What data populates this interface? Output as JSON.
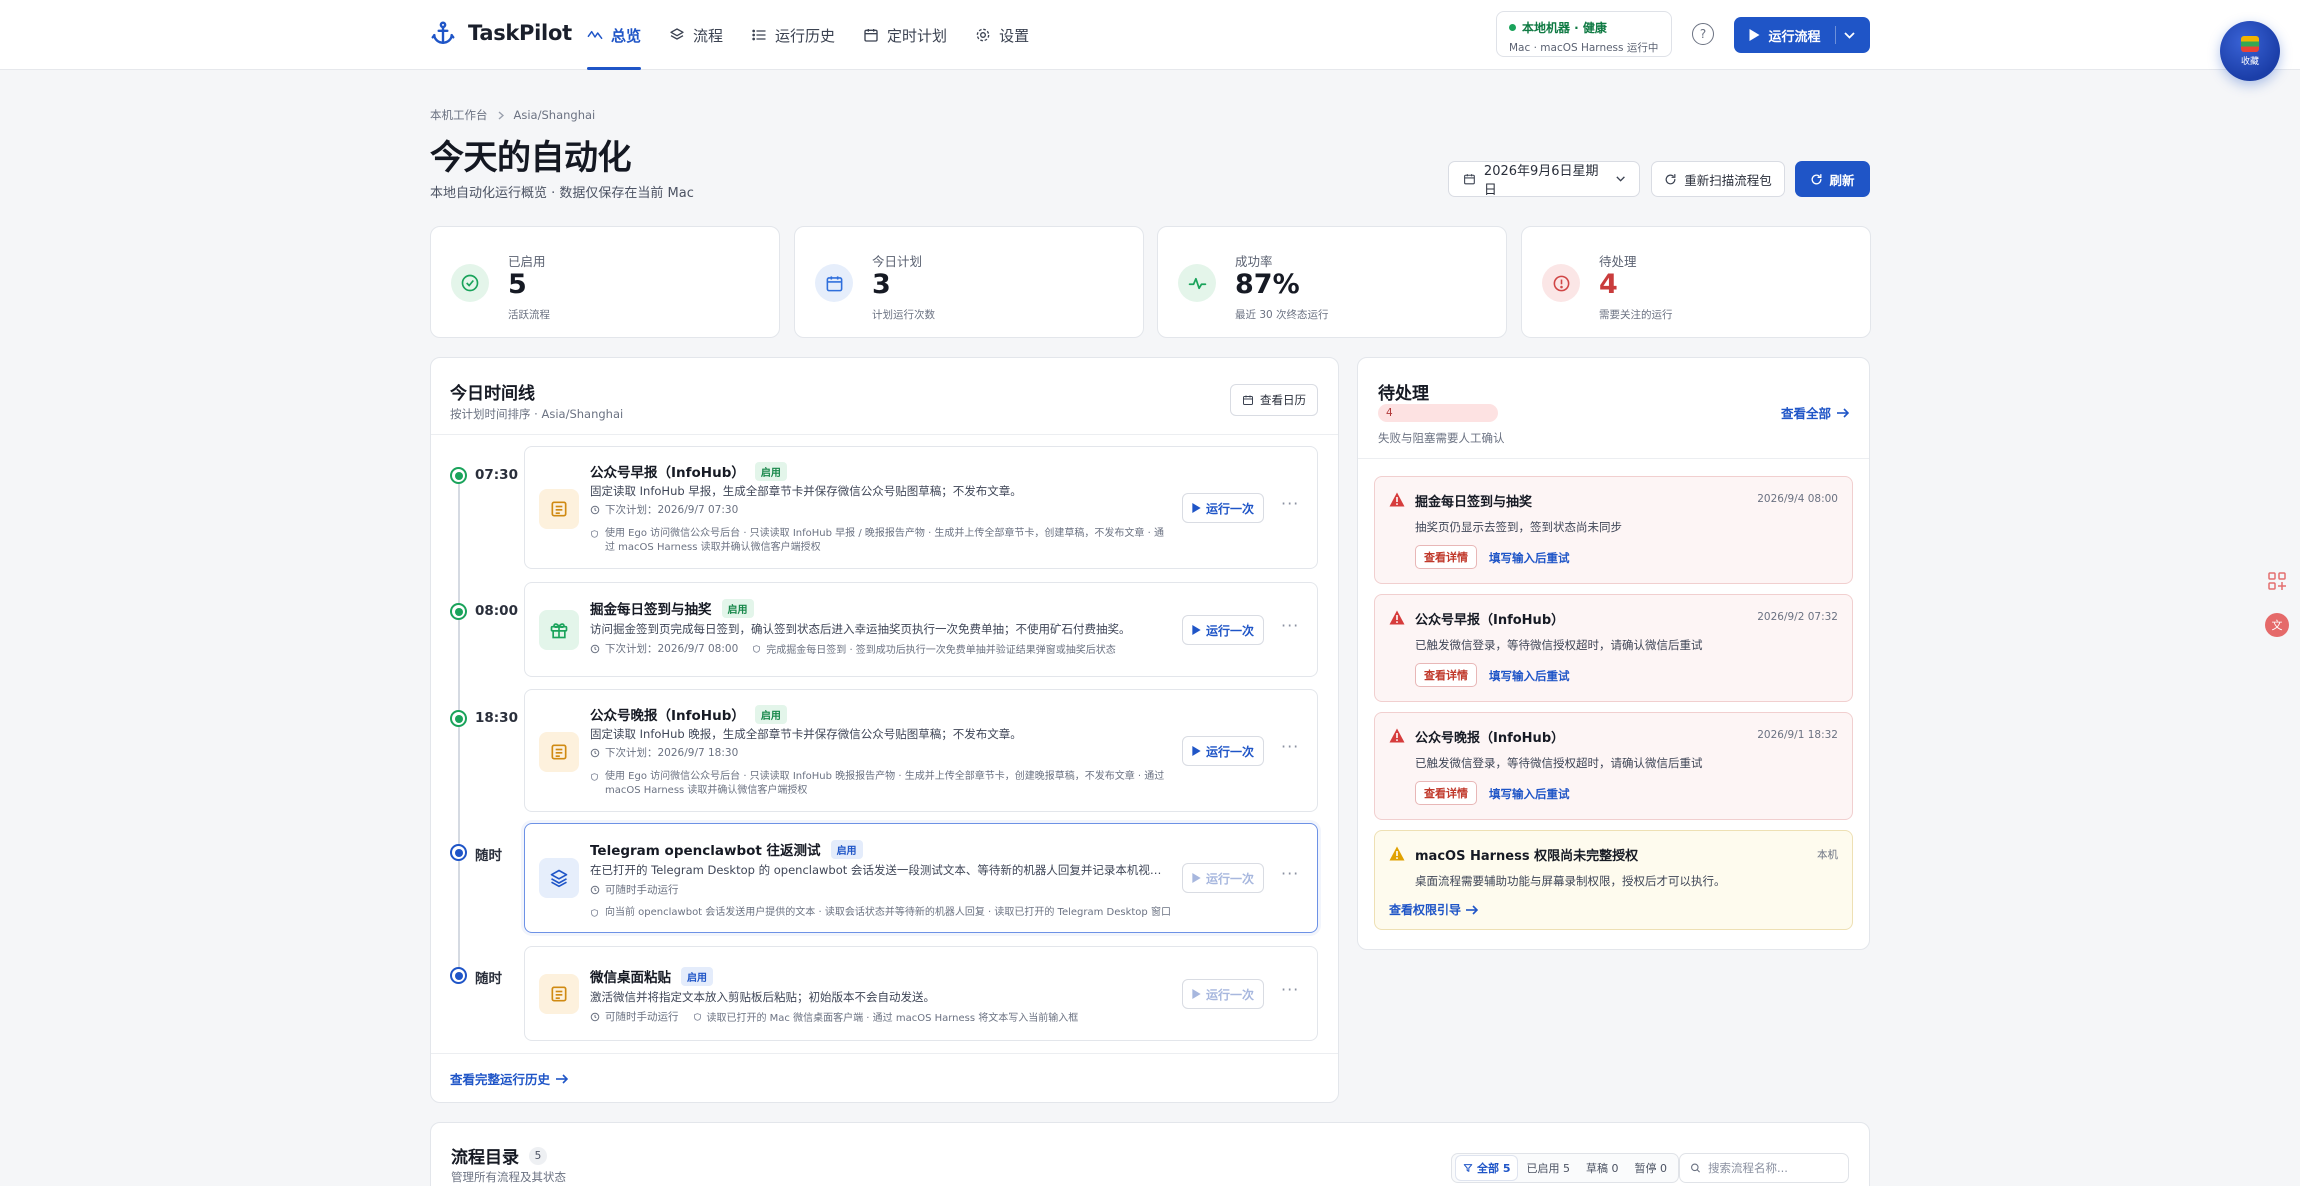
{
  "app": {
    "name": "TaskPilot"
  },
  "nav": {
    "items": [
      {
        "label": "总览",
        "icon": "activity-icon",
        "active": true
      },
      {
        "label": "流程",
        "icon": "layers-icon",
        "active": false
      },
      {
        "label": "运行历史",
        "icon": "list-icon",
        "active": false
      },
      {
        "label": "定时计划",
        "icon": "calendar-icon",
        "active": false
      },
      {
        "label": "设置",
        "icon": "gear-icon",
        "active": false
      }
    ]
  },
  "health": {
    "status": "本地机器 · 健康",
    "detail": "Mac · macOS Harness 运行中"
  },
  "header_actions": {
    "help": "?",
    "run_label": "运行流程"
  },
  "floating_badge": {
    "label": "收藏"
  },
  "breadcrumb": [
    "本机工作台",
    "Asia/Shanghai"
  ],
  "page": {
    "title": "今天的自动化",
    "subtitle": "本地自动化运行概览 · 数据仅保存在当前 Mac"
  },
  "toolbar": {
    "date": "2026年9月6日星期日",
    "rescan": "重新扫描流程包",
    "refresh": "刷新"
  },
  "stats": [
    {
      "label": "已启用",
      "value": "5",
      "note": "活跃流程",
      "color": "#1aa35b"
    },
    {
      "label": "今日计划",
      "value": "3",
      "note": "计划运行次数",
      "color": "#2f6fdc"
    },
    {
      "label": "成功率",
      "value": "87%",
      "note": "最近 30 次终态运行",
      "color": "#1aa35b"
    },
    {
      "label": "待处理",
      "value": "4",
      "note": "需要关注的运行",
      "color": "#d04545"
    }
  ],
  "timeline": {
    "title": "今日时间线",
    "subtitle": "按计划时间排序 · Asia/Shanghai",
    "calendar_btn": "查看日历",
    "jobs": [
      {
        "time": "07:30",
        "dot": "green",
        "title": "公众号早报（InfoHub）",
        "tag": "启用",
        "tag_style": "green",
        "desc": "固定读取 InfoHub 早报，生成全部章节卡并保存微信公众号贴图草稿；不发布文章。",
        "next": "下次计划：2026/9/7 07:30",
        "safe": "使用 Ego 访问微信公众号后台 · 只读读取 InfoHub 早报 / 晚报报告产物 · 生成并上传全部章节卡，创建草稿，不发布文章 · 通过 macOS Harness 读取并确认微信客户端授权",
        "run": "运行一次",
        "disabled": false
      },
      {
        "time": "08:00",
        "dot": "green",
        "title": "掘金每日签到与抽奖",
        "tag": "启用",
        "tag_style": "green",
        "desc": "访问掘金签到页完成每日签到，确认签到状态后进入幸运抽奖页执行一次免费单抽；不使用矿石付费抽奖。",
        "next": "下次计划：2026/9/7 08:00",
        "safe_inline": "完成掘金每日签到 · 签到成功后执行一次免费单抽并验证结果弹窗或抽奖后状态",
        "run": "运行一次",
        "disabled": false
      },
      {
        "time": "18:30",
        "dot": "green",
        "title": "公众号晚报（InfoHub）",
        "tag": "启用",
        "tag_style": "green",
        "desc": "固定读取 InfoHub 晚报，生成全部章节卡并保存微信公众号贴图草稿；不发布文章。",
        "next": "下次计划：2026/9/7 18:30",
        "safe": "使用 Ego 访问微信公众号后台 · 只读读取 InfoHub 晚报报告产物 · 生成并上传全部章节卡，创建晚报草稿，不发布文章 · 通过 macOS Harness 读取并确认微信客户端授权",
        "run": "运行一次",
        "disabled": false
      },
      {
        "time": "随时",
        "dot": "blue",
        "title": "Telegram openclawbot 往返测试",
        "tag": "启用",
        "tag_style": "blue",
        "desc": "在已打开的 Telegram Desktop 的 openclawbot 会话发送一段测试文本、等待新的机器人回复并记录本机视觉模型...",
        "next": "可随时手动运行",
        "safe": "向当前 openclawbot 会话发送用户提供的文本 · 读取会话状态并等待新的机器人回复 · 读取已打开的 Telegram Desktop 窗口",
        "run": "运行一次",
        "disabled": true
      },
      {
        "time": "随时",
        "dot": "blue",
        "title": "微信桌面粘贴",
        "tag": "启用",
        "tag_style": "blue",
        "desc": "激活微信并将指定文本放入剪贴板后粘贴；初始版本不会自动发送。",
        "next": "可随时手动运行",
        "safe_inline": "读取已打开的 Mac 微信桌面客户端 · 通过 macOS Harness 将文本写入当前输入框",
        "run": "运行一次",
        "disabled": true
      }
    ],
    "history_link": "查看完整运行历史"
  },
  "pending": {
    "title": "待处理",
    "count": "4",
    "subtitle": "失败与阻塞需要人工确认",
    "view_all": "查看全部",
    "items": [
      {
        "title": "掘金每日签到与抽奖",
        "time": "2026/9/4 08:00",
        "desc": "抽奖页仍显示去签到，签到状态尚未同步",
        "detail": "查看详情",
        "retry": "填写输入后重试",
        "kind": "error"
      },
      {
        "title": "公众号早报（InfoHub）",
        "time": "2026/9/2 07:32",
        "desc": "已触发微信登录，等待微信授权超时，请确认微信后重试",
        "detail": "查看详情",
        "retry": "填写输入后重试",
        "kind": "error"
      },
      {
        "title": "公众号晚报（InfoHub）",
        "time": "2026/9/1 18:32",
        "desc": "已触发微信登录，等待微信授权超时，请确认微信后重试",
        "detail": "查看详情",
        "retry": "填写输入后重试",
        "kind": "error"
      },
      {
        "title": "macOS Harness 权限尚未完整授权",
        "time": "本机",
        "desc": "桌面流程需要辅助功能与屏幕录制权限，授权后才可以执行。",
        "link": "查看权限引导",
        "kind": "warn"
      }
    ]
  },
  "catalog": {
    "title": "流程目录",
    "count": "5",
    "subtitle": "管理所有流程及其状态",
    "filters": [
      "全部 5",
      "已启用 5",
      "草稿 0",
      "暂停 0"
    ],
    "search_placeholder": "搜索流程名称..."
  },
  "colors": {
    "accent": "#1f55c7",
    "success": "#1aa35b",
    "danger": "#d04545",
    "warning": "#e0a100"
  }
}
